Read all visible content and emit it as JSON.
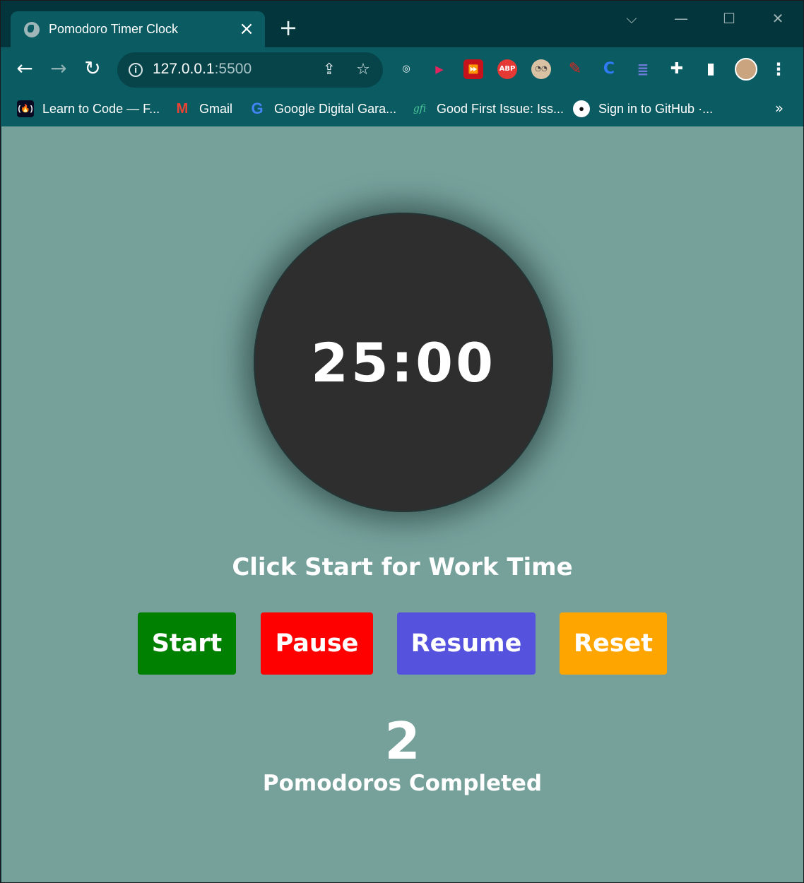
{
  "browser": {
    "tab": {
      "title": "Pomodoro Timer Clock",
      "close_glyph": "×",
      "favicon": "globe-icon"
    },
    "new_tab_glyph": "+",
    "window_controls": {
      "minimize": "—",
      "maximize": "☐",
      "close": "✕",
      "tab_search": "⌵"
    },
    "nav": {
      "back": "←",
      "forward": "→",
      "reload": "↻"
    },
    "address": {
      "host": "127.0.0.1",
      "port": ":5500"
    },
    "extensions": [
      {
        "name": "target-extension-icon",
        "glyph": "◎",
        "color": "#ffffff"
      },
      {
        "name": "play-extension-icon",
        "glyph": "▶",
        "color": "#e0245e"
      },
      {
        "name": "forward-extension-icon",
        "glyph": "⏩",
        "color": "#d11a1a"
      },
      {
        "name": "adblock-extension-icon",
        "glyph": "ABP",
        "color": "#e53935"
      },
      {
        "name": "glasses-extension-icon",
        "glyph": "◔◔",
        "color": "#c9b39b"
      },
      {
        "name": "marker-extension-icon",
        "glyph": "✎",
        "color": "#e0241d"
      },
      {
        "name": "c-extension-icon",
        "glyph": "C",
        "color": "#2f7bf5"
      },
      {
        "name": "search-extension-icon",
        "glyph": "≣",
        "color": "#6e7bd9"
      },
      {
        "name": "puzzle-extension-icon",
        "glyph": "✚",
        "color": "#ffffff"
      },
      {
        "name": "sidepanel-icon",
        "glyph": "▮",
        "color": "#ffffff"
      }
    ],
    "menu_glyph": "⋮",
    "bookmarks": [
      {
        "label": "Learn to Code — F...",
        "icon": "freecodecamp-icon"
      },
      {
        "label": "Gmail",
        "icon": "gmail-icon"
      },
      {
        "label": "Google Digital Gara...",
        "icon": "google-icon"
      },
      {
        "label": "Good First Issue: Iss...",
        "icon": "gfi-icon"
      },
      {
        "label": "Sign in to GitHub ·...",
        "icon": "github-icon"
      }
    ],
    "bookmarks_more": "»"
  },
  "app": {
    "timer": "25:00",
    "status": "Click Start for Work Time",
    "buttons": {
      "start": "Start",
      "pause": "Pause",
      "resume": "Resume",
      "reset": "Reset"
    },
    "colors": {
      "background": "#76a19b",
      "clock_face": "#2e2e2e",
      "start": "#008000",
      "pause": "#ff0000",
      "resume": "#5552de",
      "reset": "#ffa500"
    },
    "completed_count": "2",
    "completed_label": "Pomodoros Completed"
  }
}
